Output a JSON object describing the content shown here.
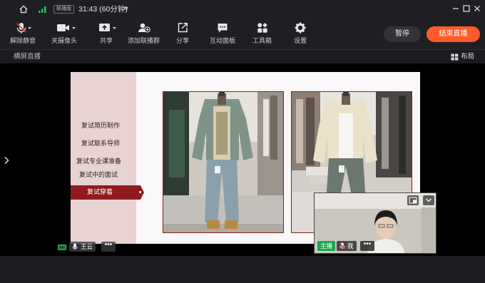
{
  "titlebar": {
    "badge": "联播版",
    "timer": "31:43 (60分钟)"
  },
  "toolbar": {
    "items": [
      {
        "label": "解除静音",
        "icon": "mic-muted-icon"
      },
      {
        "label": "关摄像头",
        "icon": "camera-icon"
      },
      {
        "label": "共享",
        "icon": "share-screen-icon"
      },
      {
        "label": "添加联播群",
        "icon": "add-group-icon"
      },
      {
        "label": "分享",
        "icon": "external-share-icon"
      },
      {
        "label": "互动面板",
        "icon": "chat-panel-icon"
      },
      {
        "label": "工具箱",
        "icon": "toolbox-icon"
      },
      {
        "label": "设置",
        "icon": "gear-icon"
      }
    ],
    "pause_label": "暂停",
    "end_label": "结束直播"
  },
  "subbar": {
    "title": "横屏直播",
    "layout_label": "布局"
  },
  "slide": {
    "menu": [
      "复试简历制作",
      "复试联系导师",
      "复试专业课准备",
      "复试中的面试"
    ],
    "active_item": "复试穿着"
  },
  "camera": {
    "host_tag": "主播",
    "me_tag": "我"
  },
  "screen_share": {
    "speaker_label": "王云"
  },
  "colors": {
    "accent": "#ff5a29",
    "host_green": "#1aa84c",
    "slide_red": "#8e1c1f"
  }
}
